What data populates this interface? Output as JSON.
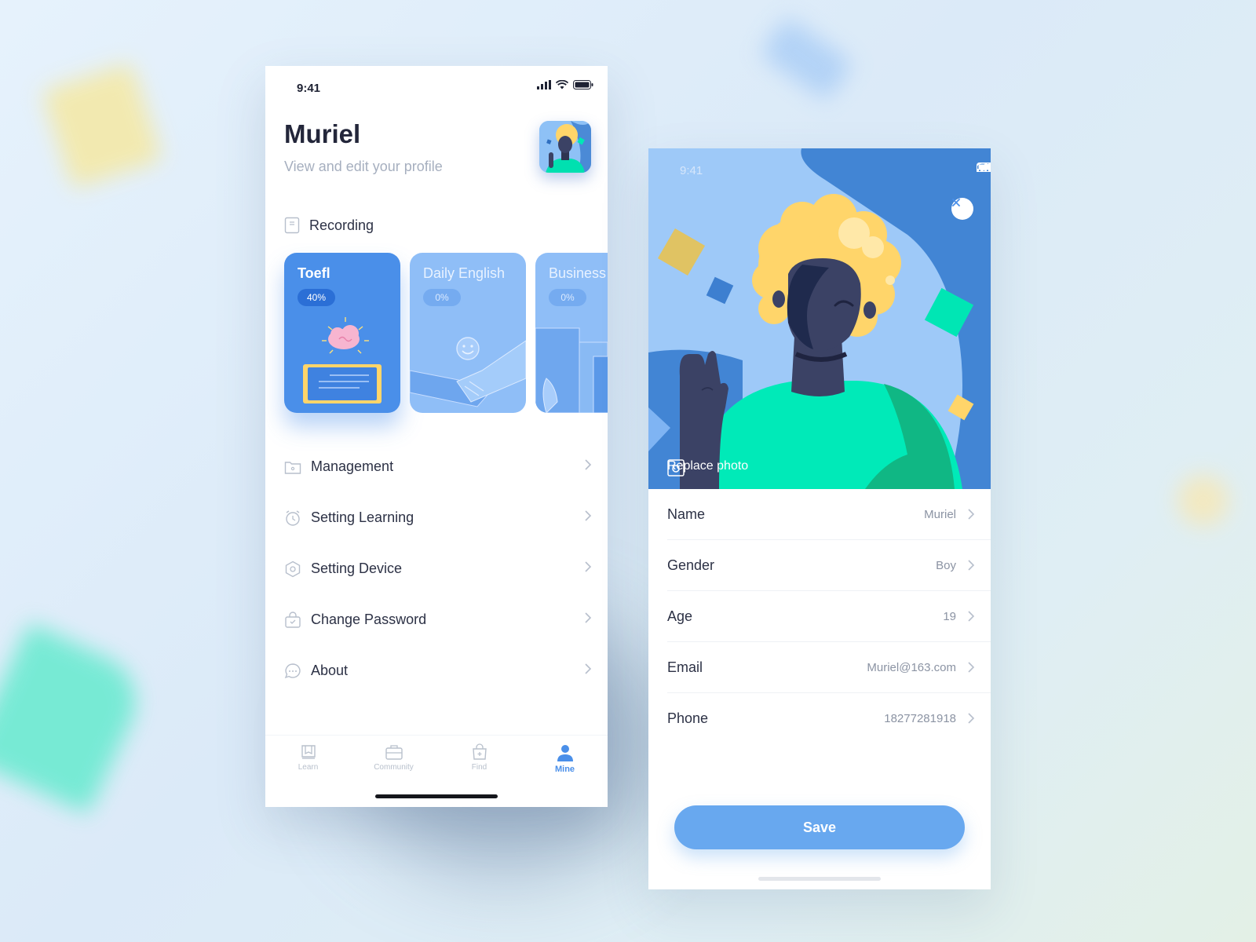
{
  "colors": {
    "accent": "#4a8fe9",
    "accent_light": "#8fbef7",
    "save_button": "#68a8ef",
    "text_primary": "#2c3145",
    "text_secondary": "#a6afbf",
    "hero_bg": "#9ec9f8",
    "hero_wave": "#4285d4",
    "shirt": "#00e9b8",
    "hair": "#ffd56a"
  },
  "profile_screen": {
    "status_time": "9:41",
    "title": "Muriel",
    "subtitle": "View and edit your profile",
    "avatar_icon": "user-illustration-avatar",
    "recording": {
      "icon": "document-icon",
      "label": "Recording"
    },
    "courses": [
      {
        "title": "Toefl",
        "progress": "40%",
        "progress_value": 40,
        "active": true,
        "icon": "cloud-book-illustration"
      },
      {
        "title": "Daily English",
        "progress": "0%",
        "progress_value": 0,
        "active": false,
        "icon": "handshake-illustration"
      },
      {
        "title": "Business",
        "progress": "0%",
        "progress_value": 0,
        "active": false,
        "icon": "buildings-illustration"
      }
    ],
    "menu": [
      {
        "icon": "folder-icon",
        "label": "Management"
      },
      {
        "icon": "alarm-clock-icon",
        "label": "Setting Learning"
      },
      {
        "icon": "hexagon-settings-icon",
        "label": "Setting Device"
      },
      {
        "icon": "lock-bag-icon",
        "label": "Change Password"
      },
      {
        "icon": "chat-bubble-icon",
        "label": "About"
      }
    ],
    "tabs": [
      {
        "icon": "book-icon",
        "label": "Learn",
        "active": false
      },
      {
        "icon": "briefcase-icon",
        "label": "Community",
        "active": false
      },
      {
        "icon": "shopping-bag-icon",
        "label": "Find",
        "active": false
      },
      {
        "icon": "person-icon",
        "label": "Mine",
        "active": true
      }
    ]
  },
  "edit_screen": {
    "status_time": "9:41",
    "replace_photo_label": "Replace photo",
    "fields": [
      {
        "label": "Name",
        "value": "Muriel"
      },
      {
        "label": "Gender",
        "value": "Boy"
      },
      {
        "label": "Age",
        "value": "19"
      },
      {
        "label": "Email",
        "value": "Muriel@163.com"
      },
      {
        "label": "Phone",
        "value": "18277281918"
      }
    ],
    "save_label": "Save"
  }
}
